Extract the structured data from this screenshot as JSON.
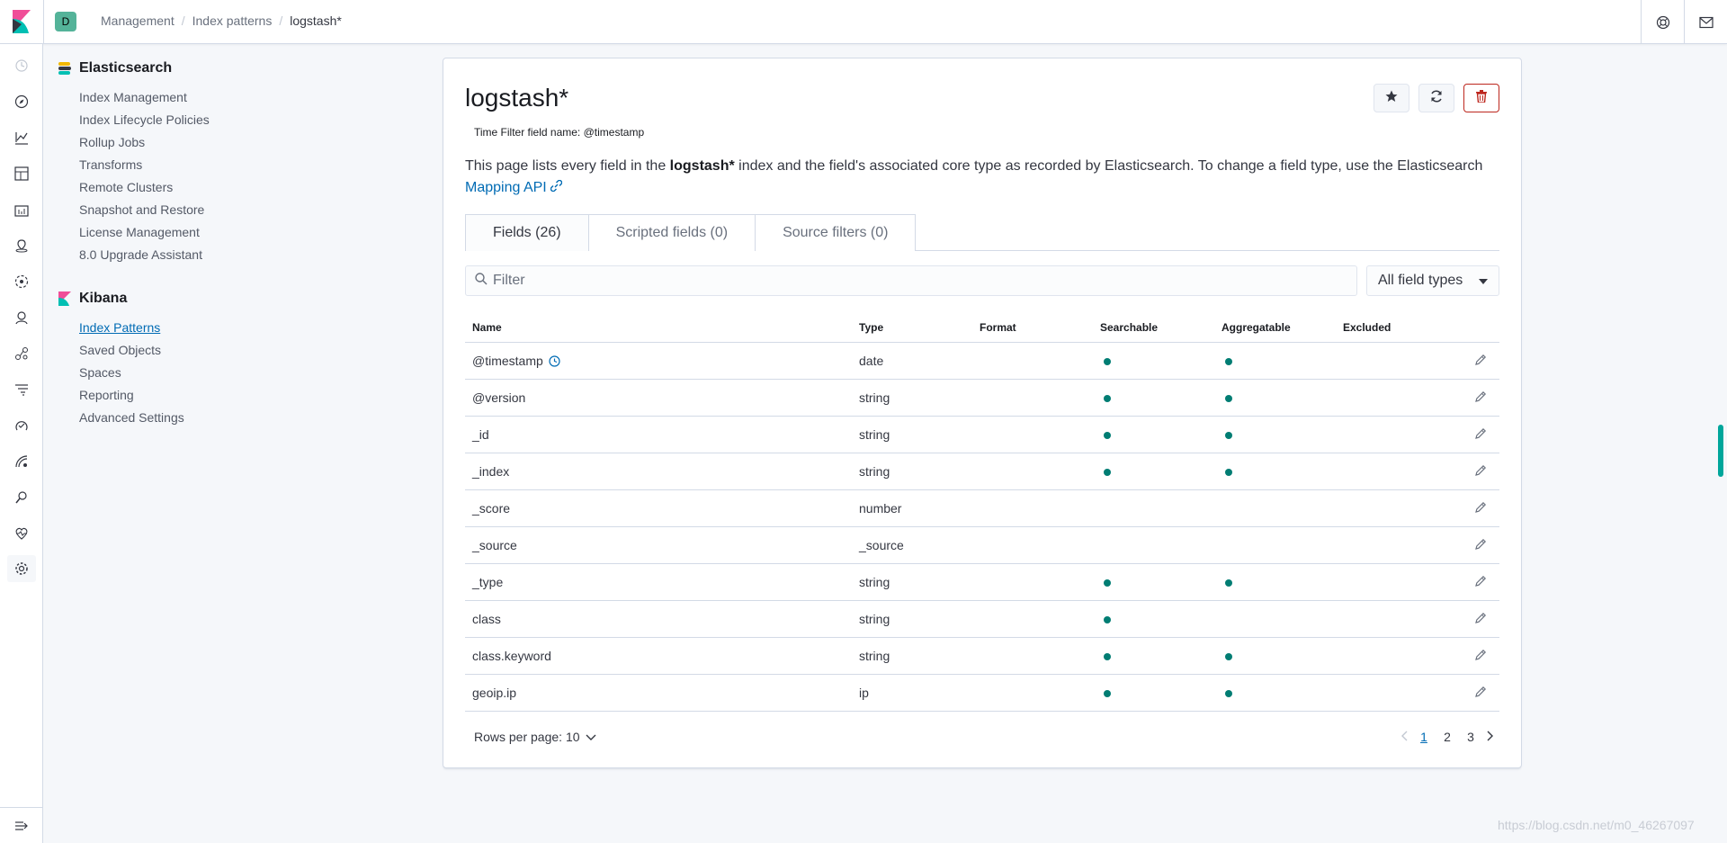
{
  "header": {
    "space_avatar": "D",
    "breadcrumbs": [
      "Management",
      "Index patterns",
      "logstash*"
    ]
  },
  "rail": {
    "icons": [
      "clock-icon",
      "compass-icon",
      "visualize-icon",
      "dashboard-icon",
      "canvas-icon",
      "maps-icon",
      "ml-icon",
      "siem-icon",
      "graph-icon",
      "apm-icon",
      "uptime-icon",
      "logs-icon",
      "dev-tools-icon",
      "monitoring-icon",
      "management-icon"
    ]
  },
  "sidenav": {
    "elasticsearch": {
      "title": "Elasticsearch",
      "items": [
        "Index Management",
        "Index Lifecycle Policies",
        "Rollup Jobs",
        "Transforms",
        "Remote Clusters",
        "Snapshot and Restore",
        "License Management",
        "8.0 Upgrade Assistant"
      ]
    },
    "kibana": {
      "title": "Kibana",
      "items": [
        "Index Patterns",
        "Saved Objects",
        "Spaces",
        "Reporting",
        "Advanced Settings"
      ],
      "active": "Index Patterns"
    }
  },
  "page": {
    "title": "logstash*",
    "time_filter": "Time Filter field name: @timestamp",
    "desc_pre": "This page lists every field in the ",
    "desc_bold": "logstash*",
    "desc_post": " index and the field's associated core type as recorded by Elasticsearch. To change a field type, use the Elasticsearch ",
    "desc_link": "Mapping API"
  },
  "tabs": [
    "Fields (26)",
    "Scripted fields (0)",
    "Source filters (0)"
  ],
  "filter": {
    "placeholder": "Filter",
    "type_select": "All field types"
  },
  "table": {
    "headers": {
      "name": "Name",
      "type": "Type",
      "format": "Format",
      "searchable": "Searchable",
      "aggregatable": "Aggregatable",
      "excluded": "Excluded"
    },
    "rows": [
      {
        "name": "@timestamp",
        "type": "date",
        "searchable": true,
        "aggregatable": true,
        "time_field": true
      },
      {
        "name": "@version",
        "type": "string",
        "searchable": true,
        "aggregatable": true
      },
      {
        "name": "_id",
        "type": "string",
        "searchable": true,
        "aggregatable": true
      },
      {
        "name": "_index",
        "type": "string",
        "searchable": true,
        "aggregatable": true
      },
      {
        "name": "_score",
        "type": "number",
        "searchable": false,
        "aggregatable": false
      },
      {
        "name": "_source",
        "type": "_source",
        "searchable": false,
        "aggregatable": false
      },
      {
        "name": "_type",
        "type": "string",
        "searchable": true,
        "aggregatable": true
      },
      {
        "name": "class",
        "type": "string",
        "searchable": true,
        "aggregatable": false
      },
      {
        "name": "class.keyword",
        "type": "string",
        "searchable": true,
        "aggregatable": true
      },
      {
        "name": "geoip.ip",
        "type": "ip",
        "searchable": true,
        "aggregatable": true
      }
    ]
  },
  "pagination": {
    "rows_per_page": "Rows per page: 10",
    "pages": [
      "1",
      "2",
      "3"
    ],
    "current": "1"
  },
  "watermark": "https://blog.csdn.net/m0_46267097",
  "colors": {
    "accent": "#006bb4",
    "dot": "#017d73",
    "danger": "#bd271e"
  }
}
